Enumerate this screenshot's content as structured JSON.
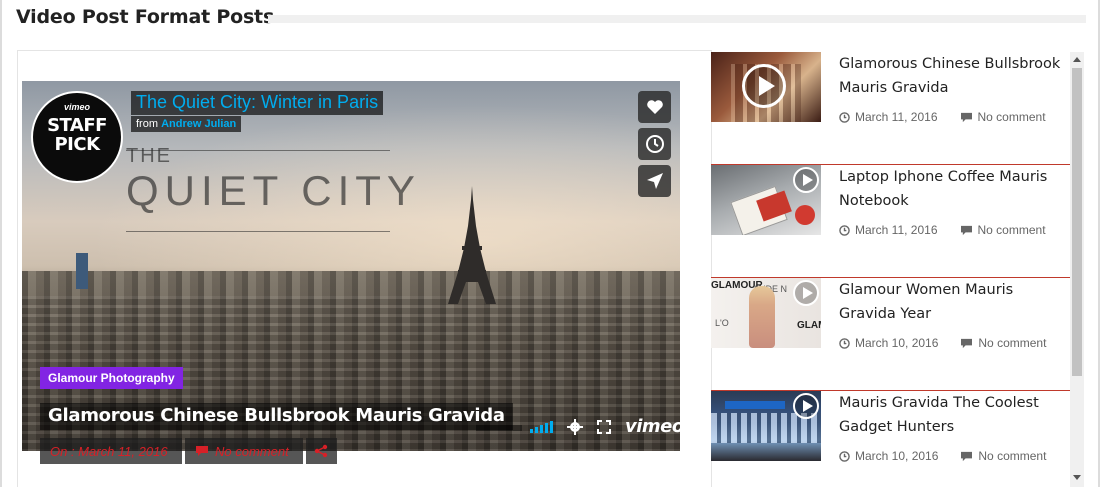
{
  "section": {
    "title": "Video Post Format Posts"
  },
  "featured": {
    "video_title": "The Quiet City: Winter in Paris",
    "from_label": "from",
    "author": "Andrew Julian",
    "staff_pick": {
      "brand": "vimeo",
      "line1": "STAFF",
      "line2": "PICK"
    },
    "poster_text": {
      "the": "THE",
      "title": "QUIET CITY"
    },
    "category": "Glamour Photography",
    "post_title": "Glamorous Chinese Bullsbrook Mauris Gravida",
    "date": "On : March 11, 2016",
    "comments": "No comment",
    "player_brand": "vimeo",
    "side_buttons": [
      "heart-icon",
      "clock-icon",
      "send-icon"
    ],
    "colors": {
      "vimeo_blue": "#00adef",
      "category": "#8224e3",
      "meta_red": "#d62027"
    }
  },
  "sidebar": {
    "items": [
      {
        "title": "Glamorous Chinese Bullsbrook Mauris Gravida",
        "date": "March 11, 2016",
        "comments": "No comment"
      },
      {
        "title": "Laptop Iphone Coffee Mauris Notebook",
        "date": "March 11, 2016",
        "comments": "No comment"
      },
      {
        "title": "Glamour Women Mauris Gravida Year",
        "date": "March 10, 2016",
        "comments": "No comment"
      },
      {
        "title": "Mauris Gravida The Coolest Gadget Hunters",
        "date": "March 10, 2016",
        "comments": "No comment"
      }
    ],
    "thumb_texts": {
      "item3": [
        "GLAMOUR",
        "ANDE N",
        "GLAM",
        "L'O"
      ]
    }
  }
}
